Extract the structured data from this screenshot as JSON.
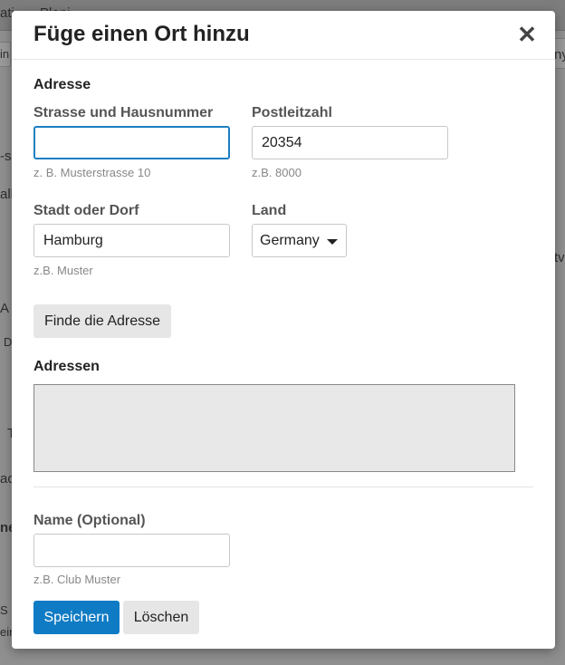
{
  "background": {
    "fragments": [
      "ati",
      "Plani",
      "in",
      "ny",
      "-s",
      "alle",
      "tv",
      "A",
      "D",
      "T",
      "ac",
      "ne",
      "S",
      "ein"
    ]
  },
  "modal": {
    "title": "Füge einen Ort hinzu",
    "close_label": "✕"
  },
  "address": {
    "section_title": "Adresse",
    "street": {
      "label": "Strasse und Hausnummer",
      "value": "",
      "hint": "z. B. Musterstrasse 10"
    },
    "postal": {
      "label": "Postleitzahl",
      "value": "20354",
      "hint": "z.B. 8000"
    },
    "city": {
      "label": "Stadt oder Dorf",
      "value": "Hamburg",
      "hint": "z.B. Muster"
    },
    "country": {
      "label": "Land",
      "value": "Germany"
    },
    "find_button": "Finde die Adresse"
  },
  "addresses": {
    "section_title": "Adressen"
  },
  "name": {
    "label": "Name (Optional)",
    "value": "",
    "hint": "z.B. Club Muster"
  },
  "actions": {
    "save": "Speichern",
    "delete": "Löschen"
  },
  "colors": {
    "primary": "#0f7bc4",
    "focus": "#1d7fc1"
  }
}
